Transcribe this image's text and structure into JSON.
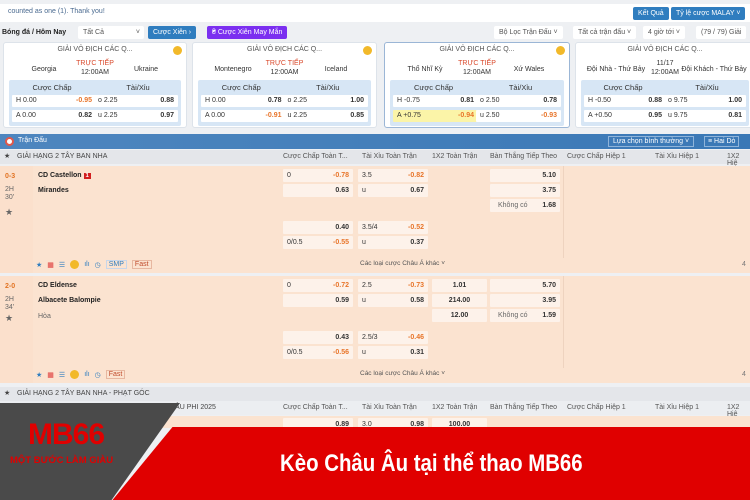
{
  "notice": "counted as one (1). Thank you!",
  "top_buttons": {
    "results": "Kết Quả",
    "odds_type": "Tỷ lệ cược MALAY"
  },
  "filters": {
    "breadcrumb": "Bóng đá / Hôm Nay",
    "sport_select": "Tất Cả",
    "parlay": "Cược Xiên",
    "lucky_parlay": "Cược Xiên May Mắn",
    "match_filter": "Bộ Lọc Trận Đấu",
    "all_matches": "Tất cả trận đấu",
    "time": "4 giờ tới",
    "league_count": "(79 / 79) Giải"
  },
  "cards": [
    {
      "league": "GIẢI VÔ ĐỊCH CÁC Q...",
      "home": "Georgia",
      "away": "Ukraine",
      "status": "TRỰC TIẾP",
      "time": "12:00AM",
      "hdp_label": "Cược Chấp",
      "ou_label": "Tài/Xỉu",
      "h_line": "H 0.00",
      "h_odds": "-0.95",
      "a_line": "A 0.00",
      "a_odds": "0.82",
      "o_line": "o 2.25",
      "o_odds": "0.88",
      "u_line": "u 2.25",
      "u_odds": "0.97"
    },
    {
      "league": "GIẢI VÔ ĐỊCH CÁC Q...",
      "home": "Montenegro",
      "away": "Iceland",
      "status": "TRỰC TIẾP",
      "time": "12:00AM",
      "hdp_label": "Cược Chấp",
      "ou_label": "Tài/Xỉu",
      "h_line": "H 0.00",
      "h_odds": "0.78",
      "a_line": "A 0.00",
      "a_odds": "-0.91",
      "o_line": "o 2.25",
      "o_odds": "1.00",
      "u_line": "u 2.25",
      "u_odds": "0.85"
    },
    {
      "league": "GIẢI VÔ ĐỊCH CÁC Q...",
      "home": "Thổ Nhĩ Kỳ",
      "away": "Xứ Wales",
      "status": "TRỰC TIẾP",
      "time": "12:00AM",
      "hdp_label": "Cược Chấp",
      "ou_label": "Tài/Xỉu",
      "h_line": "H -0.75",
      "h_odds": "0.81",
      "a_line": "A +0.75",
      "a_odds": "-0.94",
      "o_line": "o 2.50",
      "o_odds": "0.78",
      "u_line": "u 2.50",
      "u_odds": "-0.93"
    },
    {
      "league": "GIẢI VÔ ĐỊCH CÁC Q...",
      "home": "Đội Nhà - Thứ Bảy",
      "away": "Đội Khách - Thứ Bảy",
      "status": "11/17",
      "time": "12:00AM",
      "hdp_label": "Cược Chấp",
      "ou_label": "Tài/Xỉu",
      "h_line": "H -0.50",
      "h_odds": "0.88",
      "a_line": "A +0.50",
      "a_odds": "0.95",
      "o_line": "o 9.75",
      "o_odds": "1.00",
      "u_line": "u 9.75",
      "u_odds": "0.81"
    }
  ],
  "section": {
    "title": "Trận Đấu",
    "view_select": "Lựa chọn bình thường",
    "two_rows": "Hai Dò"
  },
  "columns": [
    "Cược Chấp Toàn T...",
    "Tài Xỉu Toàn Trận",
    "1X2 Toàn Trận",
    "Bàn Thắng Tiếp Theo",
    "Cược Chấp Hiệp 1",
    "Tài Xỉu Hiệp 1",
    "1X2 Hiệ"
  ],
  "leagues": [
    {
      "name": "GIẢI HẠNG 2 TÂY BAN NHA"
    },
    {
      "name": "GIẢI HẠNG 2 TÂY BAN NHA - PHẠT GÓC"
    }
  ],
  "matches": [
    {
      "score": "0-3",
      "period": "2H",
      "minute": "30'",
      "home": "CD Castellon",
      "red_card": "1",
      "away": "Mirandes",
      "draw": "",
      "hdp1": [
        "0",
        "-0.78"
      ],
      "hdp2": [
        "",
        "0.63"
      ],
      "hdp3": [
        "",
        "0.40"
      ],
      "hdp4": [
        "0/0.5",
        "-0.55"
      ],
      "ou1": [
        "3.5",
        "-0.82"
      ],
      "ou2": [
        "u",
        "0.67"
      ],
      "ou3": [
        "3.5/4",
        "-0.52"
      ],
      "ou4": [
        "u",
        "0.37"
      ],
      "x12": [
        "",
        "",
        ""
      ],
      "next1": "5.10",
      "next2": "3.75",
      "none_label": "Không có",
      "none_odds": "1.68",
      "tools": [
        "SMP",
        "Fast"
      ],
      "more": "Các loại cược Châu Á khác",
      "count": "4"
    },
    {
      "score": "2-0",
      "period": "2H",
      "minute": "34'",
      "home": "CD Eldense",
      "red_card": "",
      "away": "Albacete Balompie",
      "draw": "Hòa",
      "hdp1": [
        "0",
        "-0.72"
      ],
      "hdp2": [
        "",
        "0.59"
      ],
      "hdp3": [
        "",
        "0.43"
      ],
      "hdp4": [
        "0/0.5",
        "-0.56"
      ],
      "ou1": [
        "2.5",
        "-0.73"
      ],
      "ou2": [
        "u",
        "0.58"
      ],
      "ou3": [
        "2.5/3",
        "-0.46"
      ],
      "ou4": [
        "u",
        "0.31"
      ],
      "x12": [
        "1.01",
        "214.00",
        "12.00"
      ],
      "next1": "5.70",
      "next2": "3.95",
      "none_label": "Không có",
      "none_odds": "1.59",
      "tools": [
        "",
        "Fast"
      ],
      "more": "Các loại cược Châu Á khác",
      "count": "4"
    }
  ],
  "third_league_partial": "HÂU PHI 2025",
  "third_row": {
    "hdp": "0.89",
    "ou_line": "3.0",
    "ou_odds": "0.98",
    "x12": "100.00"
  },
  "banner": {
    "logo": "MB66",
    "slogan": "MỘT BƯỚC LÀM GIÀU",
    "title": "Kèo Châu Âu tại thể thao MB66"
  },
  "colors": {
    "accent": "#2f7dbf",
    "purple": "#7b2ff0",
    "negative": "#e8752a",
    "live": "#d9492b",
    "banner_red": "#e00000"
  }
}
